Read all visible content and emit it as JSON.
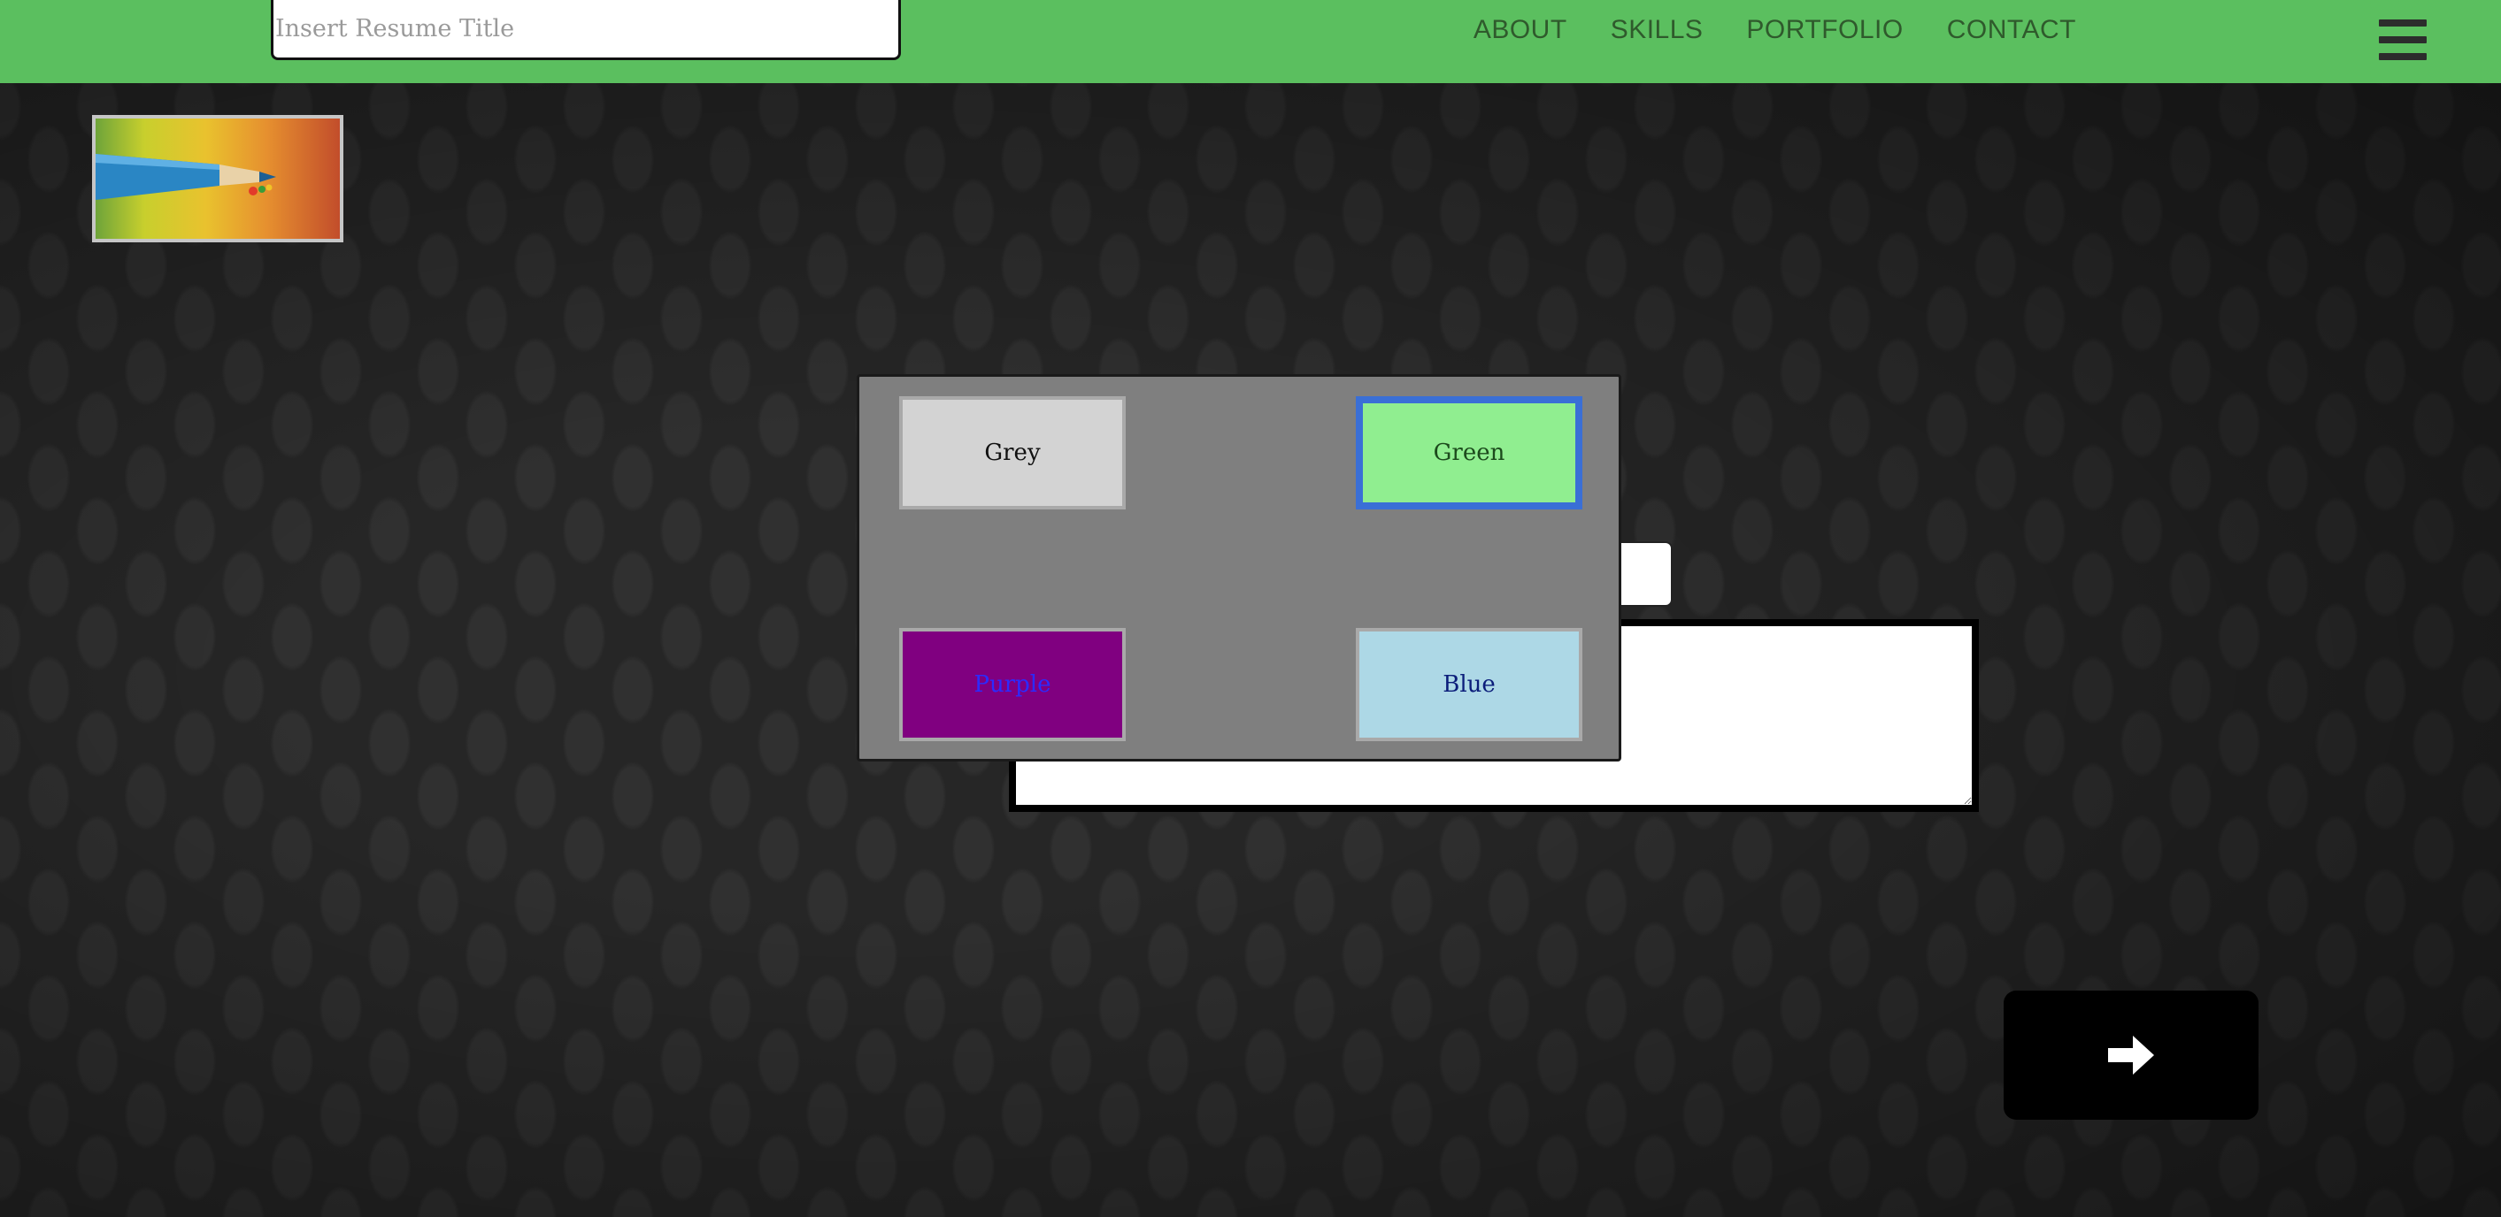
{
  "header": {
    "title_placeholder": "Insert Resume Title",
    "nav": [
      "ABOUT",
      "SKILLS",
      "PORTFOLIO",
      "CONTACT"
    ],
    "menu_icon": "hamburger-menu-icon",
    "bg_color": "#5bbf5f"
  },
  "logo": {
    "image": "colored-pencil-logo"
  },
  "color_picker": {
    "options": [
      {
        "label": "Grey",
        "color": "#d3d3d3"
      },
      {
        "label": "Green",
        "color": "#90ee90",
        "selected": true
      },
      {
        "label": "Purple",
        "color": "#800080"
      },
      {
        "label": "Blue",
        "color": "#add8e6"
      }
    ]
  },
  "next_button": {
    "icon": "arrow-right-icon"
  }
}
